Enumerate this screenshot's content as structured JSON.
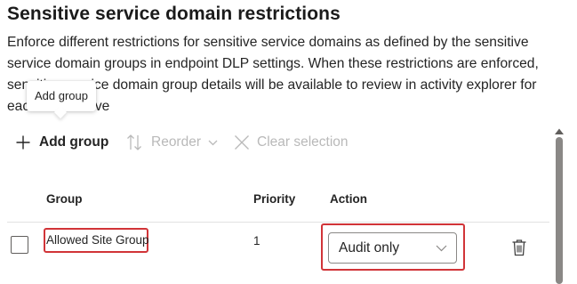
{
  "header": {
    "title": "Sensitive service domain restrictions",
    "description": "Enforce different restrictions for sensitive service domains as defined by the sensitive service domain groups in endpoint DLP settings. When these restrictions are enforced, sensitive service domain group details will be available to review in activity explorer for each related eve"
  },
  "tooltip": {
    "text": "Add group"
  },
  "toolbar": {
    "add_group": {
      "label": "Add group",
      "icon": "plus-icon",
      "enabled": true
    },
    "reorder": {
      "label": "Reorder",
      "icon": "reorder-arrows-icon",
      "enabled": false
    },
    "clear_selection": {
      "label": "Clear selection",
      "icon": "close-icon",
      "enabled": false
    }
  },
  "table": {
    "columns": {
      "group": "Group",
      "priority": "Priority",
      "action": "Action"
    },
    "rows": [
      {
        "selected": false,
        "group": "Allowed Site Group",
        "priority": "1",
        "action": "Audit only"
      }
    ]
  },
  "colors": {
    "highlight": "#d13438",
    "disabled_text": "#b9b9b9",
    "text": "#242424"
  }
}
